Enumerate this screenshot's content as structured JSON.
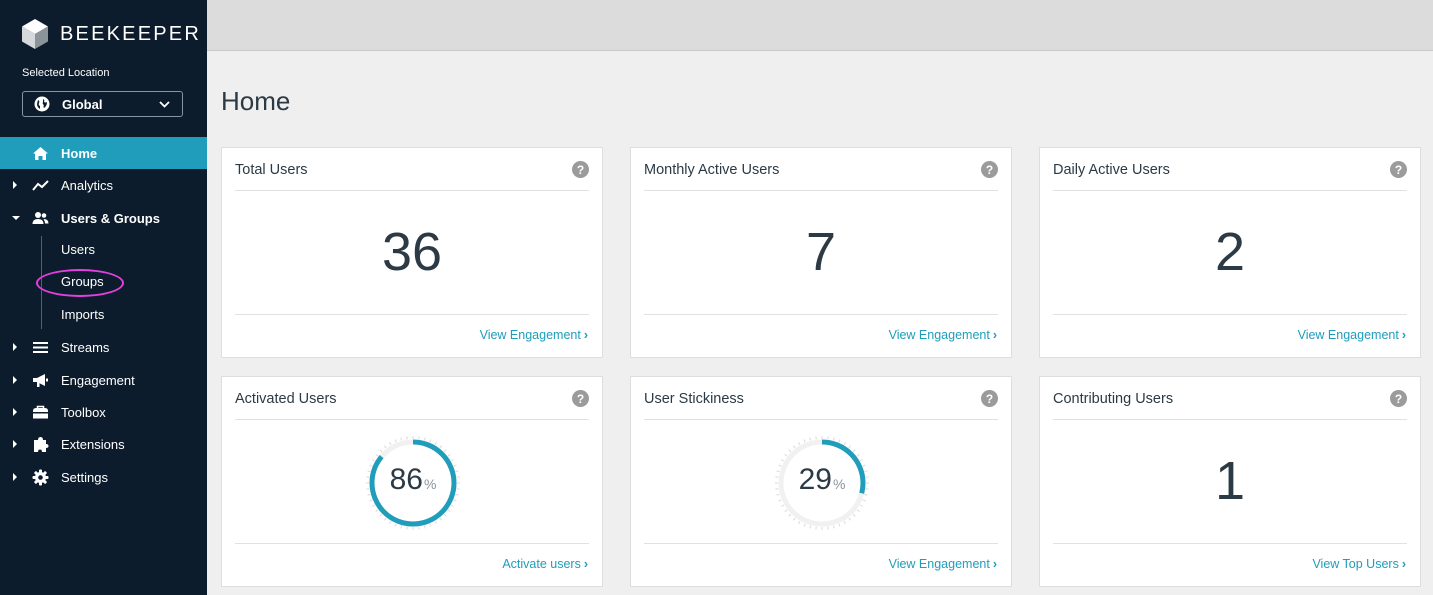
{
  "sidebar": {
    "brand": "BEEKEEPER",
    "location_label": "Selected Location",
    "location_value": "Global",
    "items": [
      {
        "label": "Home",
        "icon": "home-icon"
      },
      {
        "label": "Analytics",
        "icon": "analytics-icon"
      },
      {
        "label": "Users & Groups",
        "icon": "users-icon"
      },
      {
        "label": "Streams",
        "icon": "streams-icon"
      },
      {
        "label": "Engagement",
        "icon": "megaphone-icon"
      },
      {
        "label": "Toolbox",
        "icon": "toolbox-icon"
      },
      {
        "label": "Extensions",
        "icon": "puzzle-icon"
      },
      {
        "label": "Settings",
        "icon": "gear-icon"
      }
    ],
    "subitems": [
      "Users",
      "Groups",
      "Imports"
    ]
  },
  "page": {
    "title": "Home"
  },
  "cards": [
    {
      "title": "Total Users",
      "value": "36",
      "link": "View Engagement"
    },
    {
      "title": "Monthly Active Users",
      "value": "7",
      "link": "View Engagement"
    },
    {
      "title": "Daily Active Users",
      "value": "2",
      "link": "View Engagement"
    },
    {
      "title": "Activated Users",
      "value": "86",
      "unit": "%",
      "percent": 86,
      "link": "Activate users"
    },
    {
      "title": "User Stickiness",
      "value": "29",
      "unit": "%",
      "percent": 29,
      "link": "View Engagement"
    },
    {
      "title": "Contributing Users",
      "value": "1",
      "link": "View Top Users"
    }
  ],
  "colors": {
    "sidebar_bg": "#0d1c2c",
    "accent": "#1f9dbb",
    "annotation_circle": "#e53fe0"
  }
}
